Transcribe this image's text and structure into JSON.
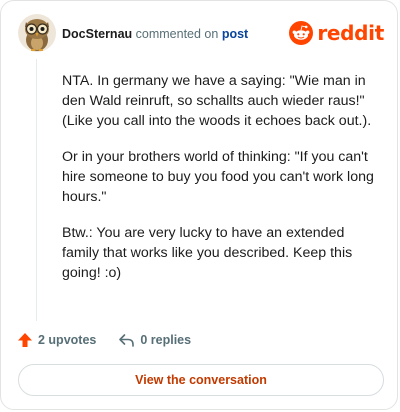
{
  "comment": {
    "author": "DocSternau",
    "action_text": "commented on",
    "post_link_text": "post",
    "paragraphs": [
      "NTA. In germany we have a saying: \"Wie man in den Wald reinruft, so schallts auch wieder raus!\" (Like you call into the woods it echoes back out.).",
      "Or in your brothers world of thinking: \"If you can't hire someone to buy you food you can't work long hours.\"",
      "Btw.: You are very lucky to have an extended family that works like you described. Keep this going! :o)"
    ]
  },
  "brand": {
    "wordmark": "reddit",
    "icon": "reddit-snoo-icon",
    "color": "#ff4500"
  },
  "stats": {
    "upvotes_label": "2 upvotes",
    "replies_label": "0 replies",
    "upvote_icon": "upvote-arrow-icon",
    "reply_icon": "reply-arrow-icon",
    "upvote_color": "#ff4500"
  },
  "cta": {
    "label": "View the conversation"
  }
}
